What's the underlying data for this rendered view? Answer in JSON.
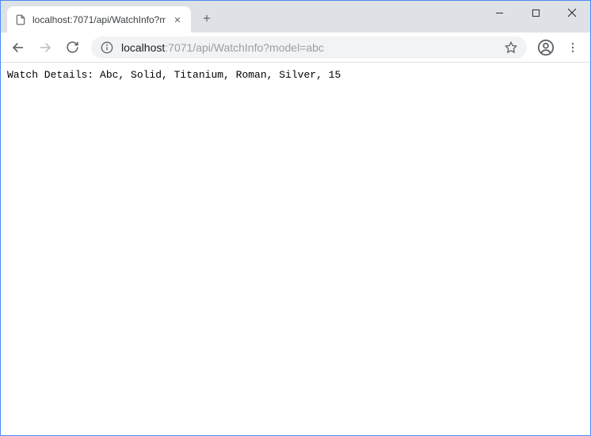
{
  "tab": {
    "title": "localhost:7071/api/WatchInfo?m"
  },
  "url": {
    "host": "localhost",
    "rest": ":7071/api/WatchInfo?model=abc"
  },
  "page": {
    "body_text": "Watch Details: Abc, Solid, Titanium, Roman, Silver, 15"
  }
}
